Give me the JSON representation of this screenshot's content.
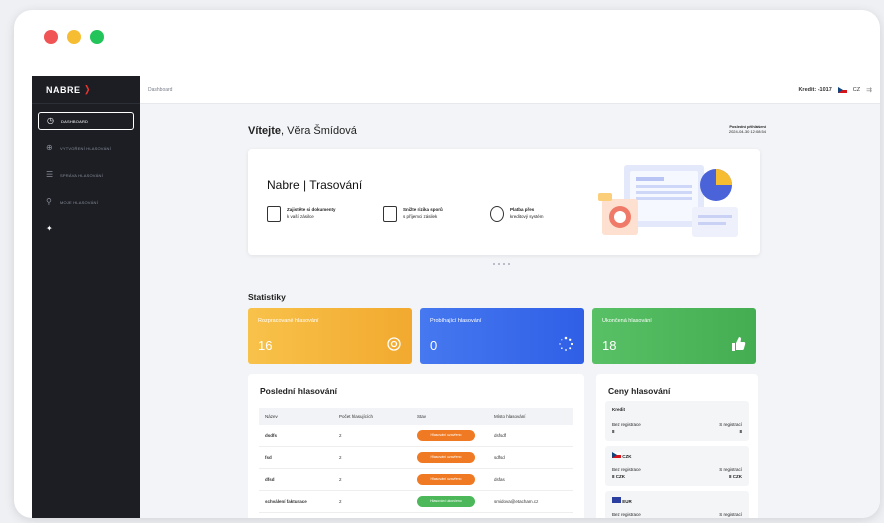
{
  "window": {
    "controls": [
      "close",
      "minimize",
      "maximize"
    ]
  },
  "colors": {
    "close": "#f05454",
    "minimize": "#f6bd32",
    "maximize": "#23c45a",
    "orange": "#f6b23b",
    "blue": "#3a6df0",
    "green": "#4cb85a"
  },
  "sidebar": {
    "logo": "NABRE",
    "items": [
      {
        "label": "DASHBOARD",
        "icon": "dashboard-icon",
        "active": true
      },
      {
        "label": "VYTVOŘENÍ HLASOVÁNÍ",
        "icon": "plus-circle-icon"
      },
      {
        "label": "SPRÁVA HLASOVÁNÍ",
        "icon": "list-icon"
      },
      {
        "label": "MOJE HLASOVÁNÍ",
        "icon": "user-icon"
      },
      {
        "label": "",
        "icon": "pin-icon"
      }
    ]
  },
  "topbar": {
    "breadcrumb": "Dashboard",
    "credit": "Kredit: -1017",
    "language": "CZ"
  },
  "welcome": {
    "greeting": "Vítejte",
    "name": ", Věra Šmídová"
  },
  "last_login": {
    "label": "Poslední přihlášení",
    "value": "2024-04-30 12:08:54"
  },
  "hero": {
    "title": "Nabre | Trasování",
    "features": [
      {
        "bold": "Zajistěte si dokumenty",
        "text": "k vaší zásilce",
        "icon": "document-icon"
      },
      {
        "bold": "Snižte rizika sporů",
        "text": "s příjemci zásilek",
        "icon": "document-check-icon"
      },
      {
        "bold": "Platba přes",
        "text": "kreditový systém",
        "icon": "coins-icon"
      }
    ]
  },
  "stats": {
    "title": "Statistiky",
    "cards": [
      {
        "label": "Rozpracované hlasování",
        "value": "16",
        "icon": "gear-icon"
      },
      {
        "label": "Probíhající hlasování",
        "value": "0",
        "icon": "spinner-icon"
      },
      {
        "label": "Ukončená hlasování",
        "value": "18",
        "icon": "thumbs-up-icon"
      }
    ]
  },
  "recent": {
    "title": "Poslední hlasování",
    "columns": [
      "Název",
      "Počet hlasujících",
      "Stav",
      "Místo hlasování"
    ],
    "rows": [
      {
        "name": "dsdfs",
        "count": "2",
        "status": "Hlasování uzavřeno",
        "status_color": "#f07a24",
        "place": "dsfsdf"
      },
      {
        "name": "fsd",
        "count": "2",
        "status": "Hlasování uzavřeno",
        "status_color": "#f07a24",
        "place": "sdfsd"
      },
      {
        "name": "dfsd",
        "count": "2",
        "status": "Hlasování uzavřeno",
        "status_color": "#f07a24",
        "place": "dsfas"
      },
      {
        "name": "schválení fakturace",
        "count": "2",
        "status": "Hlasování ukončeno",
        "status_color": "#4cb85a",
        "place": "smidova@etacham.cz"
      }
    ]
  },
  "prices": {
    "title": "Ceny hlasování",
    "blocks": [
      {
        "title": "Kredit",
        "left_label": "Bez registrace",
        "right_label": "S registrací",
        "left_value": "8",
        "right_value": "8"
      },
      {
        "title": "CZK",
        "left_label": "Bez registrace",
        "right_label": "S registrací",
        "left_value": "8 CZK",
        "right_value": "8 CZK"
      },
      {
        "title": "EUR",
        "left_label": "Bez registrace",
        "right_label": "S registrací",
        "left_value": "",
        "right_value": ""
      }
    ]
  }
}
